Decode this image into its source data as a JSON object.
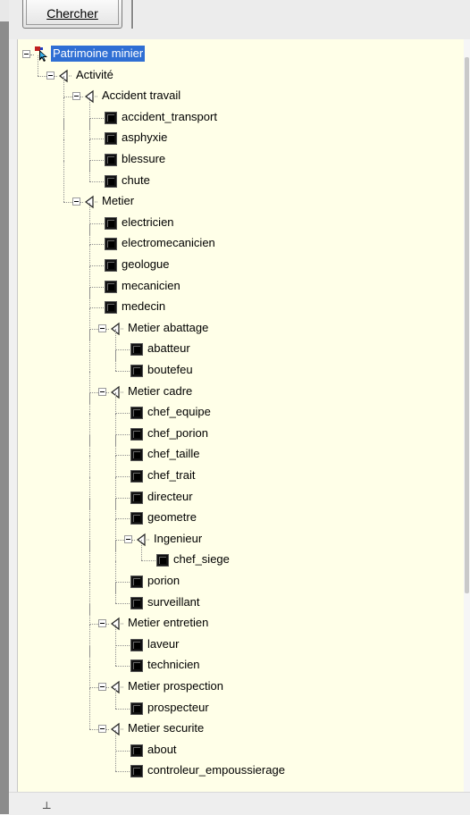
{
  "toolbar": {
    "search_label": "Chercher"
  },
  "tree": [
    {
      "label": "Patrimoine minier",
      "type": "root",
      "level": 0,
      "selected": true,
      "expanded": true,
      "icon": "root-pointer-icon"
    },
    {
      "label": "Activité",
      "type": "folder",
      "level": 1,
      "expanded": true,
      "icon": "folder-triangle-icon"
    },
    {
      "label": "Accident travail",
      "type": "folder",
      "level": 2,
      "expanded": true,
      "icon": "folder-triangle-icon"
    },
    {
      "label": "accident_transport",
      "type": "leaf",
      "level": 3,
      "icon": "leaf-square-icon"
    },
    {
      "label": "asphyxie",
      "type": "leaf",
      "level": 3,
      "icon": "leaf-square-icon"
    },
    {
      "label": "blessure",
      "type": "leaf",
      "level": 3,
      "icon": "leaf-square-icon"
    },
    {
      "label": "chute",
      "type": "leaf",
      "level": 3,
      "icon": "leaf-square-icon"
    },
    {
      "label": "Metier",
      "type": "folder",
      "level": 2,
      "expanded": true,
      "icon": "folder-triangle-icon"
    },
    {
      "label": "electricien",
      "type": "leaf",
      "level": 3,
      "icon": "leaf-square-icon"
    },
    {
      "label": "electromecanicien",
      "type": "leaf",
      "level": 3,
      "icon": "leaf-square-icon"
    },
    {
      "label": "geologue",
      "type": "leaf",
      "level": 3,
      "icon": "leaf-square-icon"
    },
    {
      "label": "mecanicien",
      "type": "leaf",
      "level": 3,
      "icon": "leaf-square-icon"
    },
    {
      "label": "medecin",
      "type": "leaf",
      "level": 3,
      "icon": "leaf-square-icon"
    },
    {
      "label": "Metier abattage",
      "type": "folder",
      "level": 3,
      "expanded": true,
      "icon": "folder-triangle-icon"
    },
    {
      "label": "abatteur",
      "type": "leaf",
      "level": 4,
      "icon": "leaf-square-icon"
    },
    {
      "label": "boutefeu",
      "type": "leaf",
      "level": 4,
      "icon": "leaf-square-icon"
    },
    {
      "label": "Metier cadre",
      "type": "folder",
      "level": 3,
      "expanded": true,
      "icon": "folder-triangle-icon"
    },
    {
      "label": "chef_equipe",
      "type": "leaf",
      "level": 4,
      "icon": "leaf-square-icon"
    },
    {
      "label": "chef_porion",
      "type": "leaf",
      "level": 4,
      "icon": "leaf-square-icon"
    },
    {
      "label": "chef_taille",
      "type": "leaf",
      "level": 4,
      "icon": "leaf-square-icon"
    },
    {
      "label": "chef_trait",
      "type": "leaf",
      "level": 4,
      "icon": "leaf-square-icon"
    },
    {
      "label": "directeur",
      "type": "leaf",
      "level": 4,
      "icon": "leaf-square-icon"
    },
    {
      "label": "geometre",
      "type": "leaf",
      "level": 4,
      "icon": "leaf-square-icon"
    },
    {
      "label": "Ingenieur",
      "type": "folder",
      "level": 4,
      "expanded": true,
      "icon": "folder-triangle-icon"
    },
    {
      "label": "chef_siege",
      "type": "leaf",
      "level": 5,
      "icon": "leaf-square-icon"
    },
    {
      "label": "porion",
      "type": "leaf",
      "level": 4,
      "icon": "leaf-square-icon"
    },
    {
      "label": "surveillant",
      "type": "leaf",
      "level": 4,
      "icon": "leaf-square-icon"
    },
    {
      "label": "Metier entretien",
      "type": "folder",
      "level": 3,
      "expanded": true,
      "icon": "folder-triangle-icon"
    },
    {
      "label": "laveur",
      "type": "leaf",
      "level": 4,
      "icon": "leaf-square-icon"
    },
    {
      "label": "technicien",
      "type": "leaf",
      "level": 4,
      "icon": "leaf-square-icon"
    },
    {
      "label": "Metier prospection",
      "type": "folder",
      "level": 3,
      "expanded": true,
      "icon": "folder-triangle-icon"
    },
    {
      "label": "prospecteur",
      "type": "leaf",
      "level": 4,
      "icon": "leaf-square-icon"
    },
    {
      "label": "Metier securite",
      "type": "folder",
      "level": 3,
      "expanded": true,
      "icon": "folder-triangle-icon"
    },
    {
      "label": "about",
      "type": "leaf",
      "level": 4,
      "icon": "leaf-square-icon"
    },
    {
      "label": "controleur_empoussierage",
      "type": "leaf",
      "level": 4,
      "icon": "leaf-square-icon"
    }
  ]
}
